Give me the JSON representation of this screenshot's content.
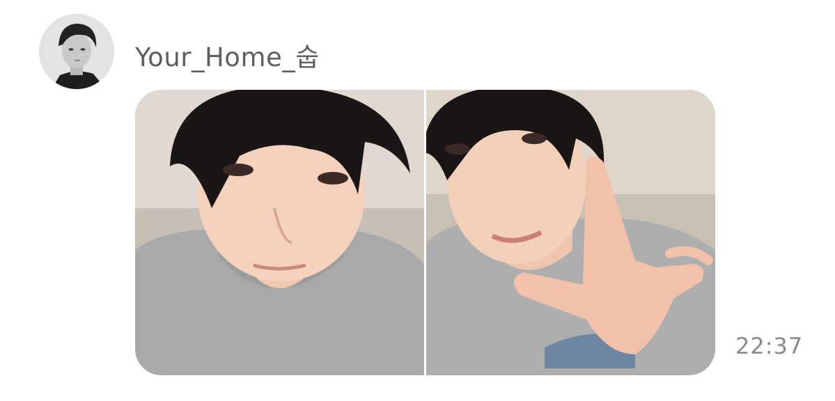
{
  "chat": {
    "sender_name": "Your_Home_숩",
    "timestamp": "22:37"
  },
  "message": {
    "type": "photo-pair",
    "photos": [
      {
        "icon": "selfie-photo"
      },
      {
        "icon": "selfie-peace-sign-photo"
      }
    ]
  },
  "colors": {
    "name_text": "#5f5f5f",
    "time_text": "#8a8a8a",
    "background": "#ffffff"
  }
}
